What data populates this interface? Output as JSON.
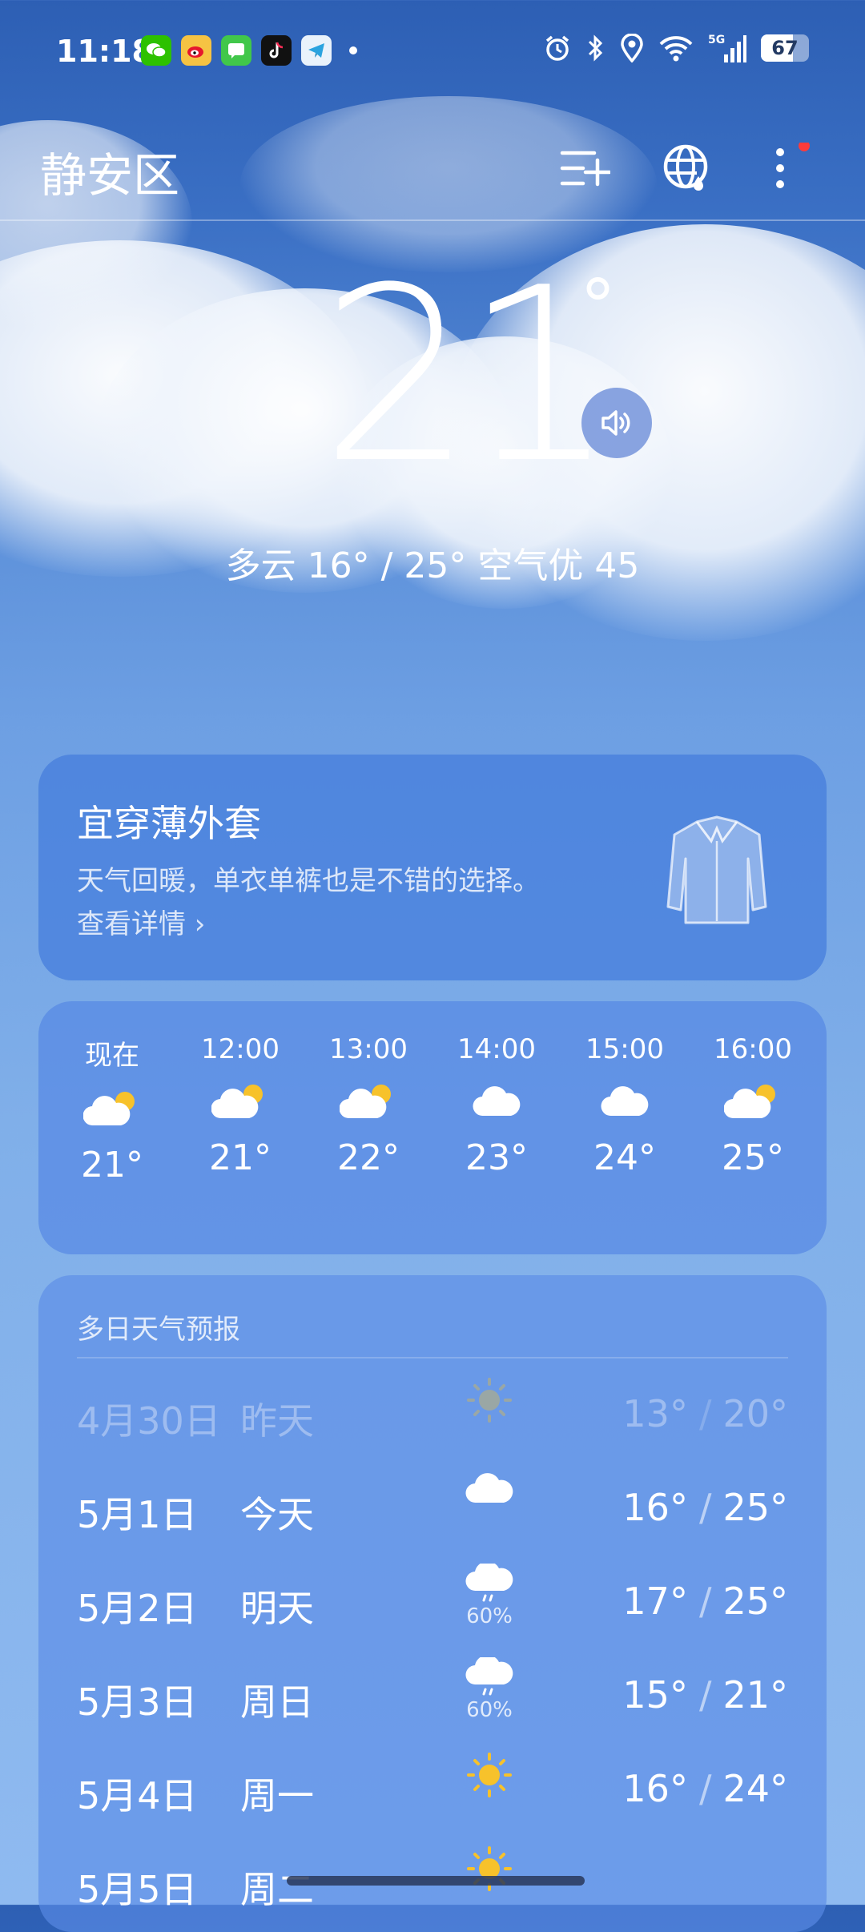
{
  "status_bar": {
    "time": "11:18",
    "apps": [
      "wechat-icon",
      "weibo-icon",
      "messages-icon",
      "tiktok-icon",
      "telegram-icon"
    ],
    "network": "5G",
    "battery": 67
  },
  "header": {
    "city": "静安区"
  },
  "current": {
    "temp": "21",
    "deg": "°",
    "summary": "多云  16° / 25°  空气优 45"
  },
  "clothing": {
    "title": "宜穿薄外套",
    "desc": "天气回暖，单衣单裤也是不错的选择。",
    "link": "查看详情 ›"
  },
  "hourly": [
    {
      "time": "现在",
      "icon": "partly-cloudy-icon",
      "temp": "21°"
    },
    {
      "time": "12:00",
      "icon": "partly-cloudy-icon",
      "temp": "21°"
    },
    {
      "time": "13:00",
      "icon": "partly-cloudy-icon",
      "temp": "22°"
    },
    {
      "time": "14:00",
      "icon": "cloud-icon",
      "temp": "23°"
    },
    {
      "time": "15:00",
      "icon": "cloud-icon",
      "temp": "24°"
    },
    {
      "time": "16:00",
      "icon": "partly-cloudy-icon",
      "temp": "25°"
    }
  ],
  "forecast": {
    "title": "多日天气预报",
    "days": [
      {
        "date": "4月30日",
        "day": "昨天",
        "icon": "sun-icon",
        "pct": "",
        "low": "13°",
        "high": "20°"
      },
      {
        "date": "5月1日",
        "day": "今天",
        "icon": "cloud-icon",
        "pct": "",
        "low": "16°",
        "high": "25°"
      },
      {
        "date": "5月2日",
        "day": "明天",
        "icon": "rain-icon",
        "pct": "60%",
        "low": "17°",
        "high": "25°"
      },
      {
        "date": "5月3日",
        "day": "周日",
        "icon": "rain-icon",
        "pct": "60%",
        "low": "15°",
        "high": "21°"
      },
      {
        "date": "5月4日",
        "day": "周一",
        "icon": "sun-icon",
        "pct": "",
        "low": "16°",
        "high": "24°"
      },
      {
        "date": "5月5日",
        "day": "周二",
        "icon": "sun-icon",
        "pct": "",
        "low": "",
        "high": ""
      }
    ]
  },
  "colors": {
    "sun": "#f7c22b",
    "notification": "#ff3b3b"
  }
}
